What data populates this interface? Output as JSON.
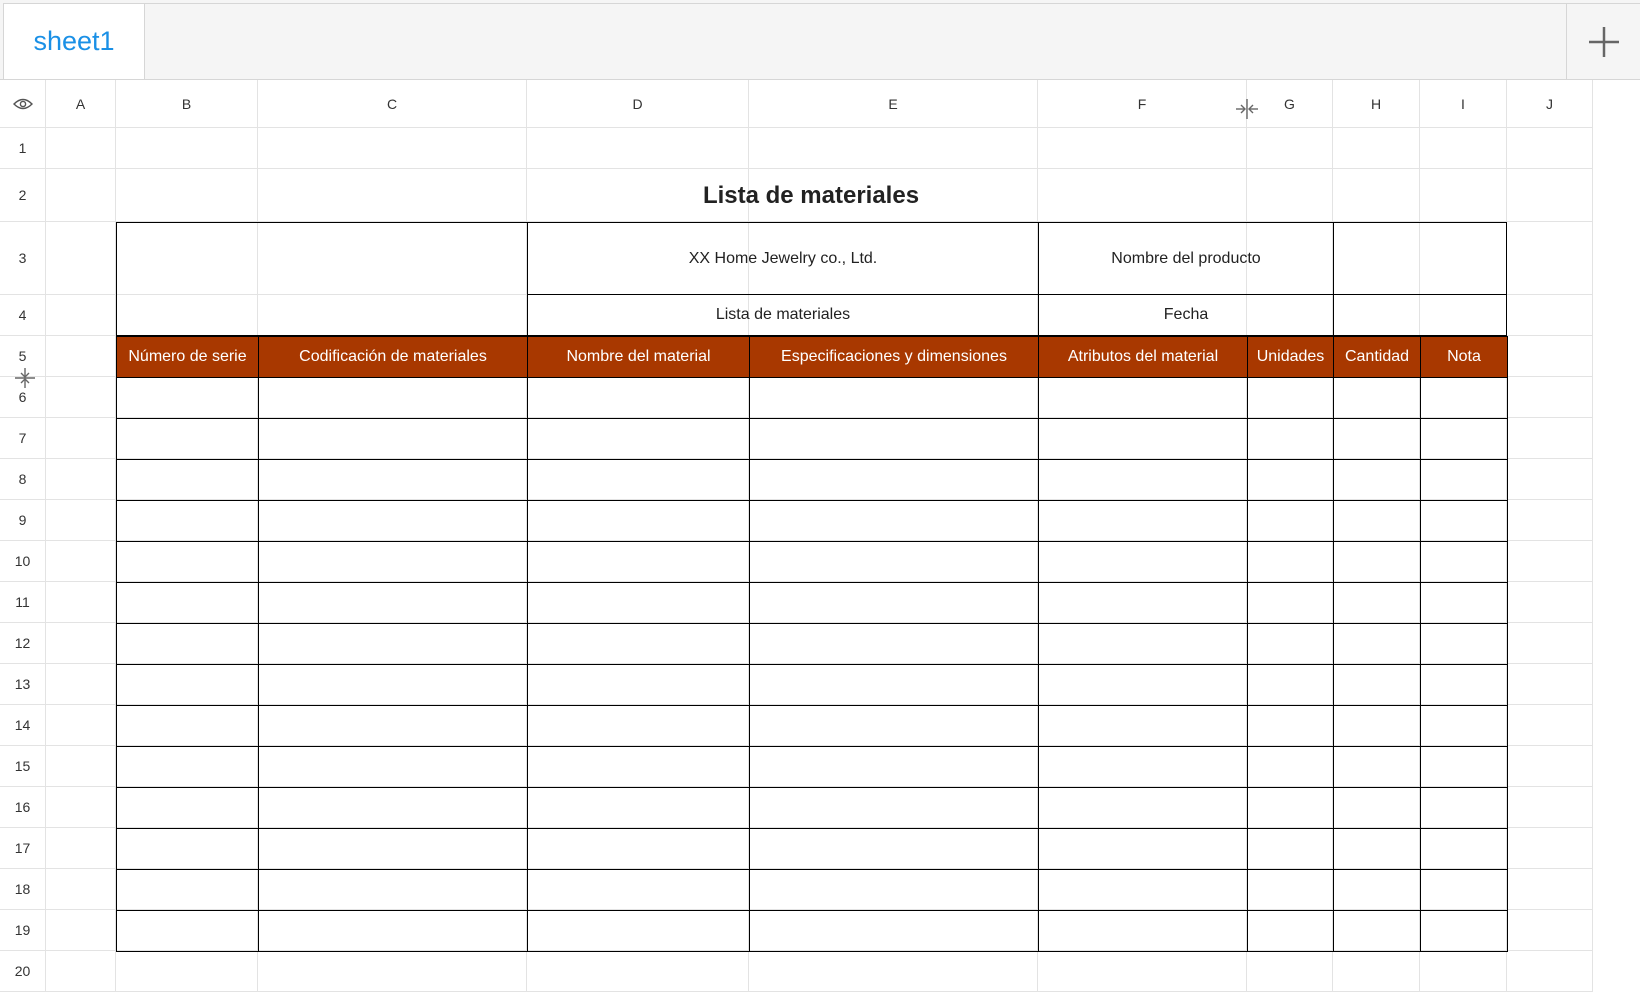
{
  "tabs": {
    "active": "sheet1",
    "add_label": "+"
  },
  "columns": [
    "A",
    "B",
    "C",
    "D",
    "E",
    "F",
    "G",
    "H",
    "I",
    "J"
  ],
  "rows": [
    "1",
    "2",
    "3",
    "4",
    "5",
    "6",
    "7",
    "8",
    "9",
    "10",
    "11",
    "12",
    "13",
    "14",
    "15",
    "16",
    "17",
    "18",
    "19",
    "20"
  ],
  "sheet": {
    "title": "Lista de materiales",
    "company": "XX Home Jewelry co., Ltd.",
    "product_label": "Nombre del producto",
    "subtitle": "Lista de materiales",
    "date_label": "Fecha",
    "headers": [
      "Número de serie",
      "Codificación de materiales",
      "Nombre del material",
      "Especificaciones y dimensiones",
      "Atributos del material",
      "Unidades",
      "Cantidad",
      "Nota"
    ]
  },
  "colors": {
    "accent": "#1a90e6",
    "header_fill": "#a83800"
  },
  "icons": {
    "visibility": "eye-icon",
    "add_sheet": "plus-icon",
    "column_resize": "column-resize-icon",
    "row_resize": "row-resize-icon"
  }
}
